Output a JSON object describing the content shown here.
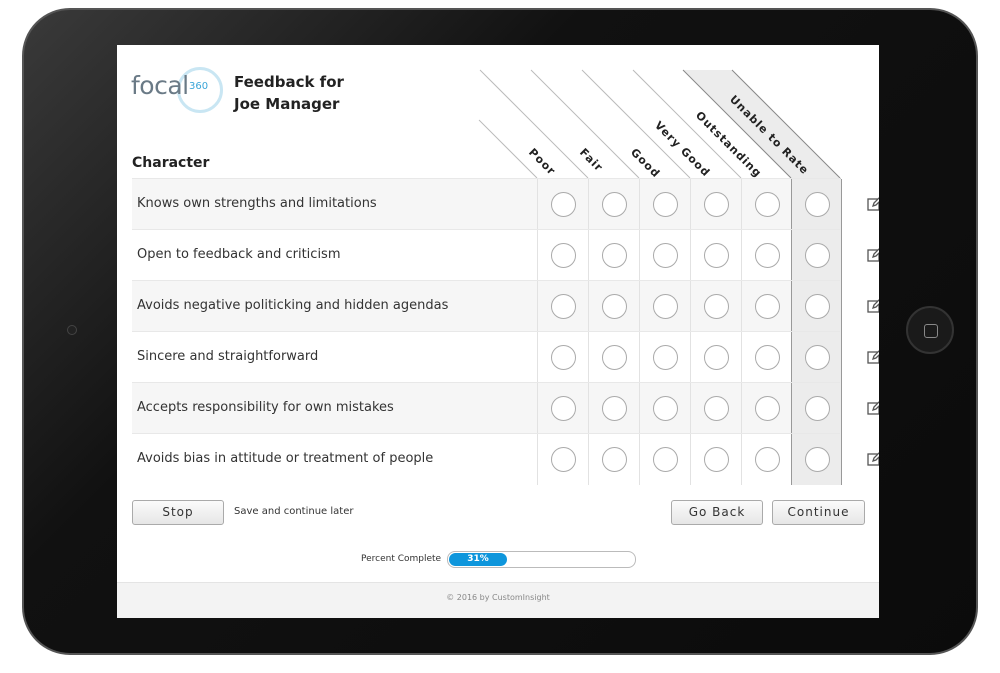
{
  "header": {
    "logo_text": "focal",
    "logo_sup": "360",
    "title_line1": "Feedback for",
    "title_line2": "Joe Manager"
  },
  "section_title": "Character",
  "columns": [
    "Poor",
    "Fair",
    "Good",
    "Very Good",
    "Outstanding",
    "Unable to Rate"
  ],
  "rows": [
    {
      "label": "Knows own strengths and limitations"
    },
    {
      "label": "Open to feedback and criticism"
    },
    {
      "label": "Avoids negative politicking and hidden agendas"
    },
    {
      "label": "Sincere and straightforward"
    },
    {
      "label": "Accepts responsibility for own mistakes"
    },
    {
      "label": "Avoids bias in attitude or treatment of people"
    }
  ],
  "row_icon": "edit-comment-icon",
  "buttons": {
    "stop": "Stop",
    "save_later": "Save and continue later",
    "go_back": "Go Back",
    "continue": "Continue"
  },
  "progress": {
    "label": "Percent Complete",
    "value": 31,
    "text": "31%"
  },
  "footer": "© 2016 by CustomInsight",
  "colors": {
    "accent": "#0e96dc",
    "logo_ring": "#c9e6f3"
  }
}
